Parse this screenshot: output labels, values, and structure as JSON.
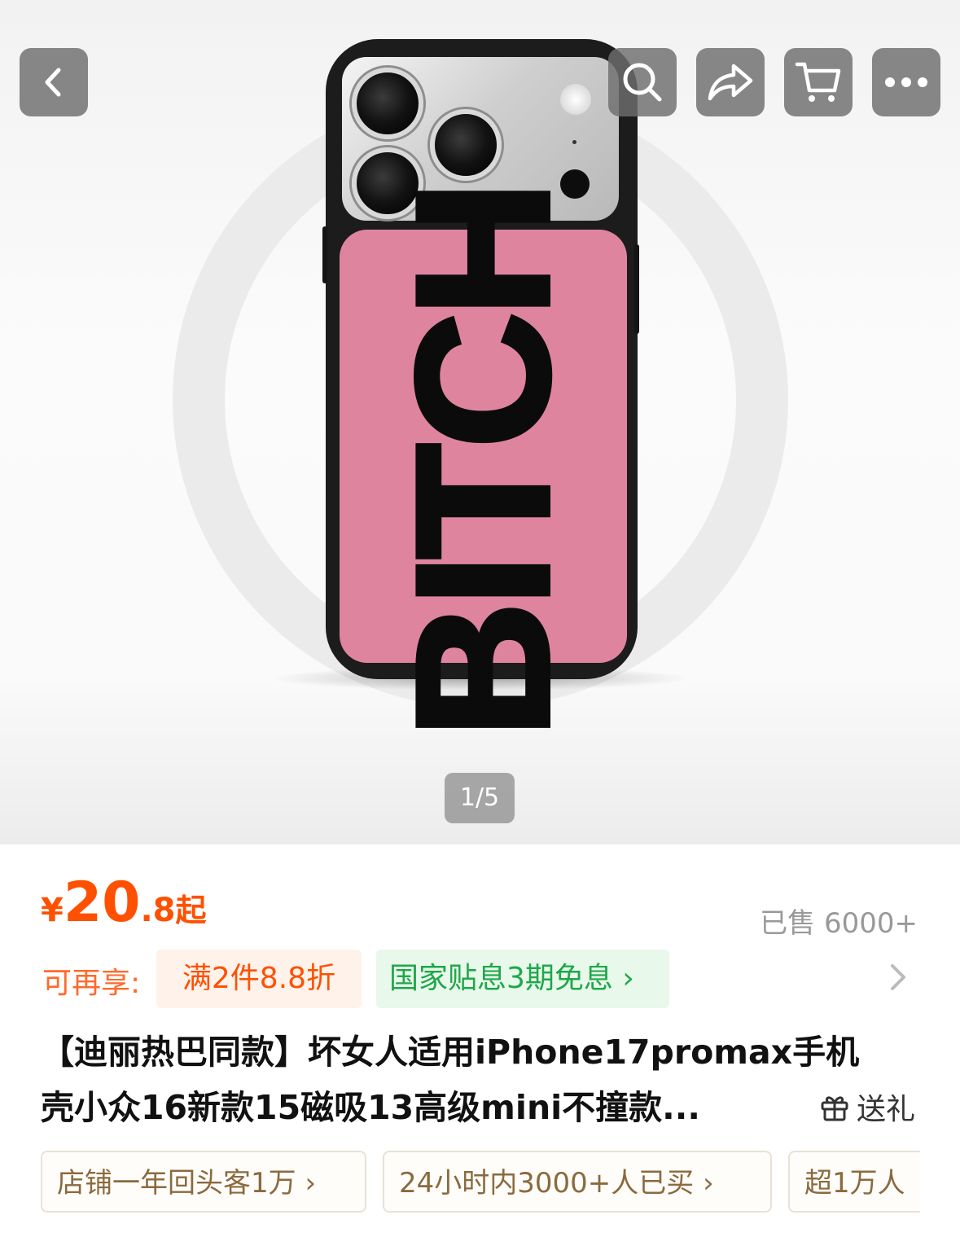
{
  "gallery": {
    "case_print": "BITCH",
    "counter": "1/5"
  },
  "nav": {
    "icons": [
      "back-icon",
      "search-icon",
      "share-icon",
      "cart-icon",
      "more-icon"
    ]
  },
  "price": {
    "currency": "¥",
    "integer": "20",
    "decimal": ".8",
    "suffix": "起",
    "color": "#ff5000"
  },
  "sold": "已售 6000+",
  "promo": {
    "label": "可再享:",
    "discount": "满2件8.8折",
    "subsidy": "国家贴息3期免息",
    "subsidy_arrow": "›"
  },
  "title": {
    "line1": "【迪丽热巴同款】坏女人适用iPhone17promax手机",
    "line2": "壳小众16新款15磁吸13高级mini不撞款..."
  },
  "gift": {
    "label": "送礼"
  },
  "tags": [
    {
      "label": "店铺一年回头客1万",
      "arrow": "›"
    },
    {
      "label": "24小时内3000+人已买",
      "arrow": "›"
    },
    {
      "label": "超1万人",
      "arrow": ""
    }
  ],
  "colors": {
    "accent": "#ff5000",
    "subsidy_green": "#1fa74a",
    "case_pink": "#df849f"
  }
}
